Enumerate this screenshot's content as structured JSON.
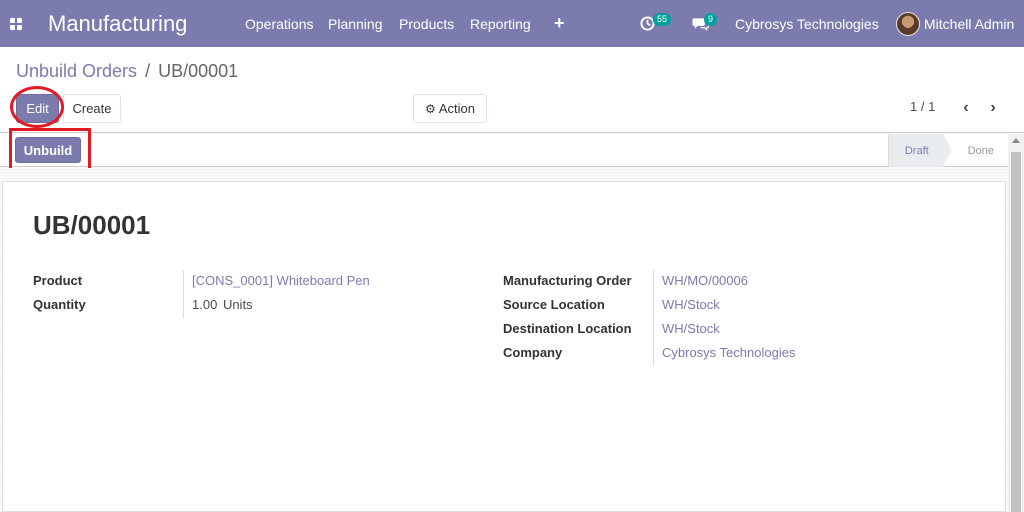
{
  "navbar": {
    "app_title": "Manufacturing",
    "menu": [
      "Operations",
      "Planning",
      "Products",
      "Reporting"
    ],
    "activity_count": "55",
    "message_count": "9",
    "company": "Cybrosys Technologies",
    "user": "Mitchell Admin"
  },
  "breadcrumb": {
    "parent": "Unbuild Orders",
    "separator": "/",
    "current": "UB/00001"
  },
  "toolbar": {
    "edit_label": "Edit",
    "create_label": "Create",
    "action_label": "Action"
  },
  "pager": {
    "value": "1 / 1"
  },
  "statusbar": {
    "unbuild_label": "Unbuild",
    "steps": [
      "Draft",
      "Done"
    ],
    "current_step": "Draft"
  },
  "record": {
    "title": "UB/00001",
    "left_fields": [
      {
        "label": "Product",
        "value": "[CONS_0001] Whiteboard Pen"
      },
      {
        "label": "Quantity",
        "value": "1.00",
        "unit": "Units"
      }
    ],
    "right_fields": [
      {
        "label": "Manufacturing Order",
        "value": "WH/MO/00006"
      },
      {
        "label": "Source Location",
        "value": "WH/Stock"
      },
      {
        "label": "Destination Location",
        "value": "WH/Stock"
      },
      {
        "label": "Company",
        "value": "Cybrosys Technologies"
      }
    ]
  },
  "colors": {
    "brand": "#7c7bad",
    "badge": "#00a09d",
    "highlight": "#e01b24"
  }
}
